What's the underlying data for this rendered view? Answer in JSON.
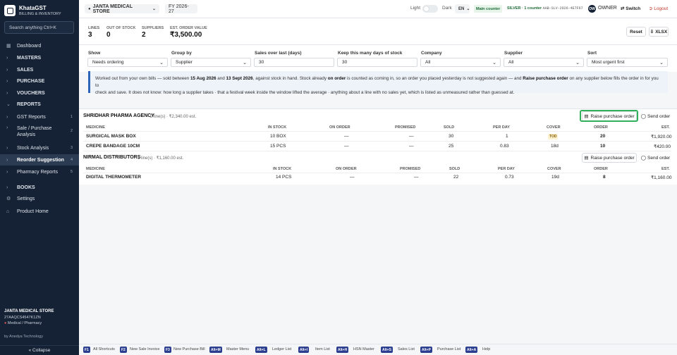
{
  "app": {
    "name": "KhataGST",
    "subtitle": "BILLING & INVENTORY",
    "search_placeholder": "Search anything Ctrl+K"
  },
  "nav": {
    "dashboard": "Dashboard",
    "masters": "MASTERS",
    "sales": "SALES",
    "purchase": "PURCHASE",
    "vouchers": "VOUCHERS",
    "reports": "REPORTS",
    "gst_reports": "GST Reports",
    "gst_reports_count": "1",
    "sale_purchase": "Sale / Purchase Analysis",
    "sale_purchase_count": "2",
    "stock_analysis": "Stock Analysis",
    "stock_analysis_count": "3",
    "reorder": "Reorder Suggestion",
    "reorder_count": "4",
    "pharmacy": "Pharmacy Reports",
    "pharmacy_count": "5",
    "books": "BOOKS",
    "settings": "Settings",
    "product_home": "Product Home"
  },
  "store": {
    "name": "JANTA MEDICAL STORE",
    "gstin": "27AAQCS4547K1ZN",
    "type": "Medical / Pharmacy",
    "by": "by Anedya Technology",
    "collapse": "« Collapse"
  },
  "topbar": {
    "company": "JANTA MEDICAL STORE",
    "fy": "FY 2026-27",
    "light": "Light",
    "dark": "Dark",
    "lang": "EN",
    "main_counter": "Main counter",
    "silver": "SILVER · 1 counter",
    "license": "AAB-SLV-2026-4E7F67",
    "avatar": "OW",
    "role": "OWNER",
    "switch": "Switch",
    "logout": "Logout"
  },
  "summary": {
    "lines_label": "LINES",
    "lines": "3",
    "out_label": "OUT OF STOCK",
    "out": "0",
    "suppliers_label": "SUPPLIERS",
    "suppliers": "2",
    "value_label": "EST. ORDER VALUE",
    "value": "₹3,500.00",
    "reset": "Reset",
    "xlsx": "XLSX"
  },
  "filters": {
    "show_label": "Show",
    "show": "Needs ordering",
    "group_label": "Group by",
    "group": "Supplier",
    "sales_label": "Sales over last (days)",
    "sales": "30",
    "keep_label": "Keep this many days of stock",
    "keep": "30",
    "company_label": "Company",
    "company": "All",
    "supplier_label": "Supplier",
    "supplier": "All",
    "sort_label": "Sort",
    "sort": "Most urgent first"
  },
  "info": {
    "t1": "Worked out from your own bills — sold between ",
    "d1": "15 Aug 2026",
    "t2": " and ",
    "d2": "13 Sept 2026",
    "t3": ", against stock in hand. Stock already ",
    "on": "on order",
    "t4": " is counted as coming in, so an order you placed yesterday is not suggested again — and ",
    "raise": "Raise purchase order",
    "t5": " on any supplier below fills the order in for you to",
    "line2": "check and save. It does not know: how long a supplier takes · that a festival week inside the window lifted the average · anything about a line with no sales yet, which is listed as unmeasured rather than guessed at."
  },
  "cols": {
    "medicine": "MEDICINE",
    "in_stock": "IN STOCK",
    "on_order": "ON ORDER",
    "promised": "PROMISED",
    "sold": "SOLD",
    "per_day": "PER DAY",
    "cover": "COVER",
    "order": "ORDER",
    "est": "EST."
  },
  "actions": {
    "raise": "Raise purchase order",
    "send": "Send order"
  },
  "groups": [
    {
      "name": "SHRIDHAR PHARMA AGENCY",
      "sub": "2 line(s) · ₹2,340.00 est.",
      "rows": [
        {
          "medicine": "SURGICAL MASK BOX",
          "in_stock": "10 BOX",
          "on_order": "—",
          "promised": "—",
          "sold": "30",
          "per_day": "1",
          "cover": "TOD",
          "order": "20",
          "est": "₹1,920.00"
        },
        {
          "medicine": "CREPE BANDAGE 10CM",
          "in_stock": "15 PCS",
          "on_order": "—",
          "promised": "—",
          "sold": "25",
          "per_day": "0.83",
          "cover": "18d",
          "order": "10",
          "est": "₹420.00"
        }
      ]
    },
    {
      "name": "NIRMAL DISTRIBUTORS",
      "sub": "1 line(s) · ₹1,160.00 est.",
      "rows": [
        {
          "medicine": "DIGITAL THERMOMETER",
          "in_stock": "14 PCS",
          "on_order": "—",
          "promised": "—",
          "sold": "22",
          "per_day": "0.73",
          "cover": "19d",
          "order": "8",
          "est": "₹1,160.00"
        }
      ]
    }
  ],
  "shortcuts": [
    {
      "key": "F1",
      "label": "All Shortcuts"
    },
    {
      "key": "F2",
      "label": "New Sale Invoice"
    },
    {
      "key": "F3",
      "label": "New Purchase Bill"
    },
    {
      "key": "Alt+M",
      "label": "Master Menu"
    },
    {
      "key": "Alt+L",
      "label": "Ledger List"
    },
    {
      "key": "Alt+I",
      "label": "Item List"
    },
    {
      "key": "Alt+H",
      "label": "HSN Master"
    },
    {
      "key": "Alt+S",
      "label": "Sales List"
    },
    {
      "key": "Alt+P",
      "label": "Purchase List"
    },
    {
      "key": "Alt+A",
      "label": "Help"
    }
  ],
  "colors": {
    "sidebar": "#152235",
    "accent": "#2b64b8",
    "highlight": "#30b05a"
  }
}
